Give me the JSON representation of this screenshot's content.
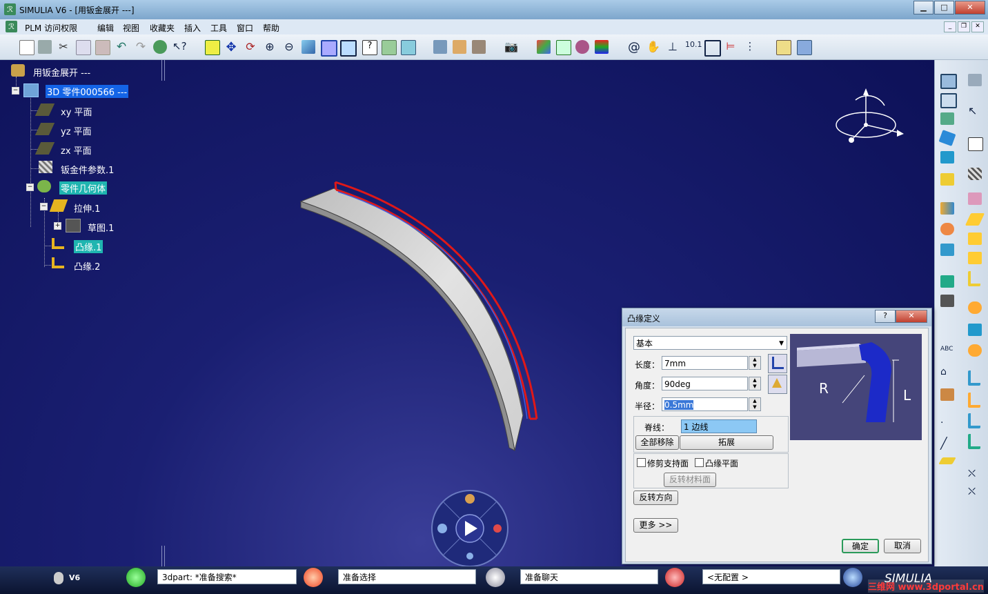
{
  "window": {
    "title": "SIMULIA V6 - [用钣金展开 ---]",
    "app_icon": "3ds-logo-icon"
  },
  "menu": [
    "PLM 访问权限",
    "编辑",
    "视图",
    "收藏夹",
    "插入",
    "工具",
    "窗口",
    "帮助"
  ],
  "tree": {
    "root": "用钣金展开 ---",
    "part": "3D 零件000566 ---",
    "planes": [
      "xy 平面",
      "yz 平面",
      "zx 平面"
    ],
    "params": "钣金件参数.1",
    "body": "零件几何体",
    "extrude": "拉伸.1",
    "sketch": "草图.1",
    "flange1": "凸缘.1",
    "flange2": "凸缘.2"
  },
  "dialog": {
    "title": "凸缘定义",
    "help": "?",
    "close": "✕",
    "mode": "基本",
    "length_label": "长度：",
    "length": "7mm",
    "angle_label": "角度：",
    "angle": "90deg",
    "radius_label": "半径：",
    "radius": "0.5mm",
    "spine_label": "脊线：",
    "spine": "1 边线",
    "remove_all": "全部移除",
    "propagate": "拓展",
    "trim_support": "修剪支持面",
    "flange_plane": "凸缘平面",
    "reverse_material": "反转材料面",
    "reverse_dir": "反转方向",
    "more": "更多 >>",
    "ok": "确定",
    "cancel": "取消",
    "preview_R": "R",
    "preview_L": "L"
  },
  "status": {
    "v6": "V6",
    "search": "3dpart: *准备搜索*",
    "select": "准备选择",
    "chat": "准备聊天",
    "config": "<无配置 >",
    "brand": "SIMULIA",
    "watermark": "三维网 www.3dportal.cn"
  },
  "colors": {
    "viewport": "#1a1f72",
    "selected": "#1464e6",
    "highlight": "#1fb5b0",
    "flange_edge": "#e01818"
  }
}
